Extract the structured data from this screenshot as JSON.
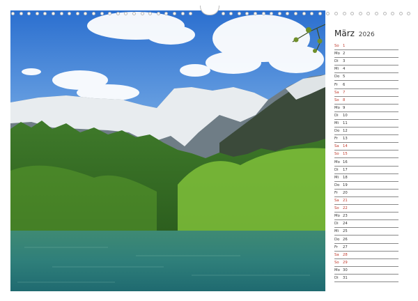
{
  "calendar": {
    "month": "März",
    "year": "2026",
    "days": [
      {
        "dow": "So",
        "day": "1",
        "weekend": true
      },
      {
        "dow": "Mo",
        "day": "2",
        "weekend": false
      },
      {
        "dow": "Di",
        "day": "3",
        "weekend": false
      },
      {
        "dow": "Mi",
        "day": "4",
        "weekend": false
      },
      {
        "dow": "Do",
        "day": "5",
        "weekend": false
      },
      {
        "dow": "Fr",
        "day": "6",
        "weekend": false
      },
      {
        "dow": "Sa",
        "day": "7",
        "weekend": true
      },
      {
        "dow": "So",
        "day": "8",
        "weekend": true
      },
      {
        "dow": "Mo",
        "day": "9",
        "weekend": false
      },
      {
        "dow": "Di",
        "day": "10",
        "weekend": false
      },
      {
        "dow": "Mi",
        "day": "11",
        "weekend": false
      },
      {
        "dow": "Do",
        "day": "12",
        "weekend": false
      },
      {
        "dow": "Fr",
        "day": "13",
        "weekend": false
      },
      {
        "dow": "Sa",
        "day": "14",
        "weekend": true
      },
      {
        "dow": "So",
        "day": "15",
        "weekend": true
      },
      {
        "dow": "Mo",
        "day": "16",
        "weekend": false
      },
      {
        "dow": "Di",
        "day": "17",
        "weekend": false
      },
      {
        "dow": "Mi",
        "day": "18",
        "weekend": false
      },
      {
        "dow": "Do",
        "day": "19",
        "weekend": false
      },
      {
        "dow": "Fr",
        "day": "20",
        "weekend": false
      },
      {
        "dow": "Sa",
        "day": "21",
        "weekend": true
      },
      {
        "dow": "So",
        "day": "22",
        "weekend": true
      },
      {
        "dow": "Mo",
        "day": "23",
        "weekend": false
      },
      {
        "dow": "Di",
        "day": "24",
        "weekend": false
      },
      {
        "dow": "Mi",
        "day": "25",
        "weekend": false
      },
      {
        "dow": "Do",
        "day": "26",
        "weekend": false
      },
      {
        "dow": "Fr",
        "day": "27",
        "weekend": false
      },
      {
        "dow": "Sa",
        "day": "28",
        "weekend": true
      },
      {
        "dow": "So",
        "day": "29",
        "weekend": true
      },
      {
        "dow": "Mo",
        "day": "30",
        "weekend": false
      },
      {
        "dow": "Di",
        "day": "31",
        "weekend": false
      }
    ]
  },
  "colors": {
    "weekend": "#c0392b",
    "weekday": "#333333",
    "sky": "#3f86d6",
    "lake": "#2f7f7a"
  }
}
